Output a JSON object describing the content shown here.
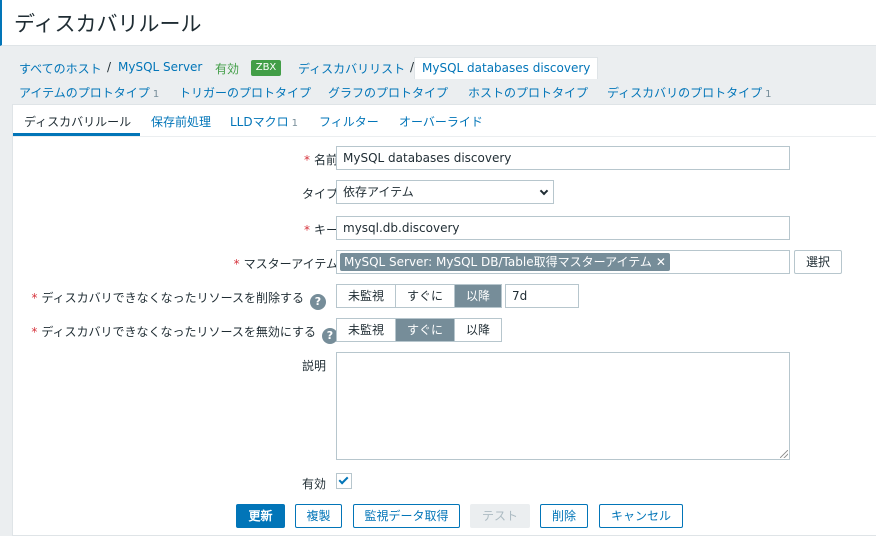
{
  "page": {
    "title": "ディスカバリルール"
  },
  "breadcrumb": {
    "all_hosts": "すべてのホスト",
    "sep": "/",
    "host": "MySQL Server",
    "status": "有効",
    "badge": "ZBX",
    "discovery_list": "ディスカバリリスト",
    "current": "MySQL databases discovery"
  },
  "prototypes": [
    {
      "label": "アイテムのプロトタイプ",
      "count": "1"
    },
    {
      "label": "トリガーのプロトタイプ",
      "count": ""
    },
    {
      "label": "グラフのプロトタイプ",
      "count": ""
    },
    {
      "label": "ホストのプロトタイプ",
      "count": ""
    },
    {
      "label": "ディスカバリのプロトタイプ",
      "count": "1"
    }
  ],
  "tabs": [
    {
      "label": "ディスカバリルール",
      "count": ""
    },
    {
      "label": "保存前処理",
      "count": ""
    },
    {
      "label": "LLDマクロ",
      "count": "1"
    },
    {
      "label": "フィルター",
      "count": ""
    },
    {
      "label": "オーバーライド",
      "count": ""
    }
  ],
  "form": {
    "required_mark": "*",
    "help_glyph": "?",
    "name_label": "名前",
    "name_value": "MySQL databases discovery",
    "type_label": "タイプ",
    "type_value": "依存アイテム",
    "key_label": "キー",
    "key_value": "mysql.db.discovery",
    "master_label": "マスターアイテム",
    "master_value": "MySQL Server: MySQL DB/Table取得マスターアイテム",
    "master_remove": "✕",
    "select_button": "選択",
    "delete_lost_label": "ディスカバリできなくなったリソースを削除する",
    "delete_lost_options": [
      "未監視",
      "すぐに",
      "以降"
    ],
    "delete_lost_selected": "以降",
    "delete_lost_period": "7d",
    "disable_lost_label": "ディスカバリできなくなったリソースを無効にする",
    "disable_lost_options": [
      "未監視",
      "すぐに",
      "以降"
    ],
    "disable_lost_selected": "すぐに",
    "description_label": "説明",
    "description_value": "",
    "enabled_label": "有効",
    "enabled_checked": true
  },
  "buttons": {
    "update": "更新",
    "clone": "複製",
    "check_now": "監視データ取得",
    "test": "テスト",
    "delete": "削除",
    "cancel": "キャンセル"
  },
  "colors": {
    "link": "#0275b8",
    "enabled": "#429e47",
    "required": "#d6333c",
    "selected_segment": "#768d99"
  }
}
